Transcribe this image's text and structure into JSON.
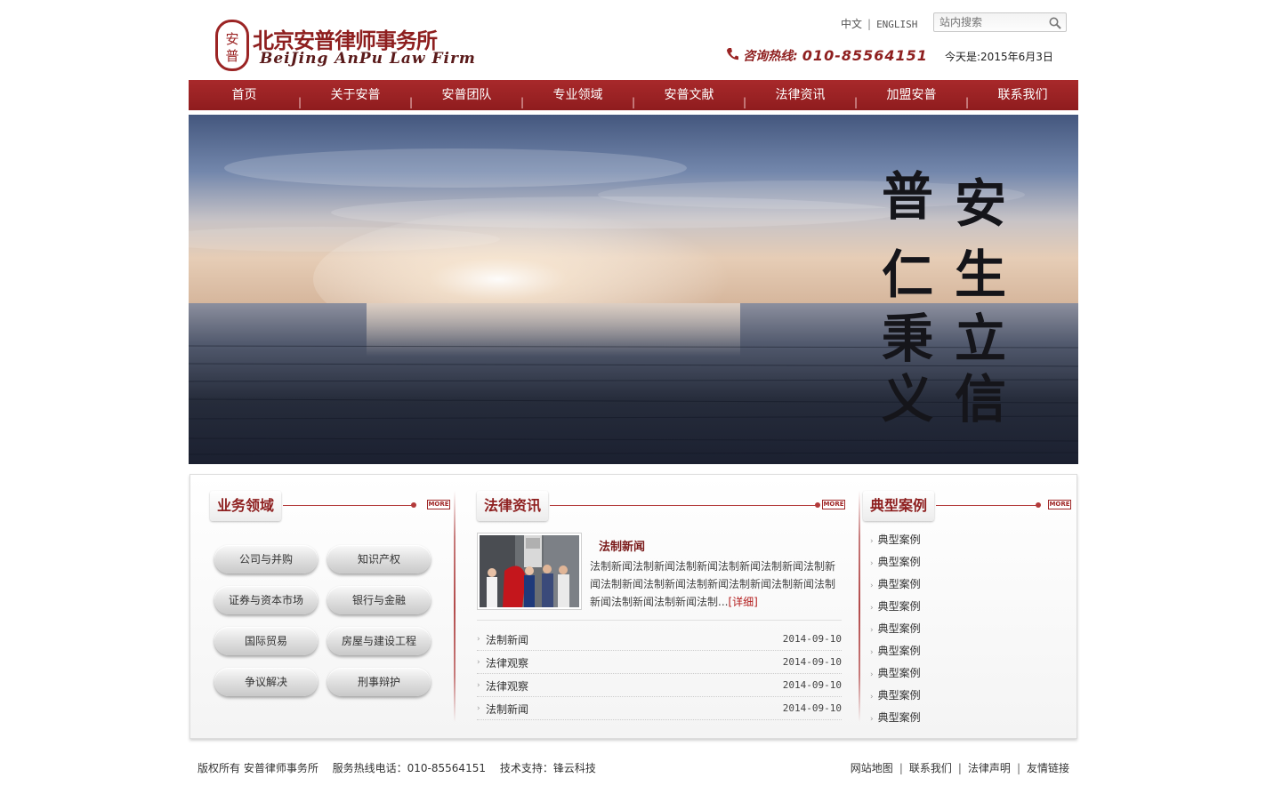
{
  "header": {
    "logo_seal_text": "安普",
    "logo_cn": "北京安普律师事务所",
    "logo_en": "BeiJing AnPu Law Firm",
    "lang_cn": "中文",
    "lang_en": "ENGLISH",
    "search_placeholder": "站内搜索",
    "hotline_label": "咨询热线:",
    "hotline_number": "010-85564151",
    "today_label": "今天是:",
    "today_date": "2015年6月3日"
  },
  "nav": {
    "items": [
      "首页",
      "关于安普",
      "安普团队",
      "专业领域",
      "安普文献",
      "法律资讯",
      "加盟安普",
      "联系我们"
    ]
  },
  "banner": {
    "calligraphy_col1": "普仁秉义",
    "calligraphy_col2": "安生立信"
  },
  "practice": {
    "title": "业务领域",
    "more": "MORE",
    "items": [
      "公司与并购",
      "知识产权",
      "证券与资本市场",
      "银行与金融",
      "国际贸易",
      "房屋与建设工程",
      "争议解决",
      "刑事辩护"
    ]
  },
  "news": {
    "title": "法律资讯",
    "more": "MORE",
    "featured_title": "法制新闻",
    "featured_text": "法制新闻法制新闻法制新闻法制新闻法制新闻法制新闻法制新闻法制新闻法制新闻法制新闻法制新闻法制新闻法制新闻法制新闻法制...",
    "detail_link": "[详细]",
    "list": [
      {
        "title": "法制新闻",
        "date": "2014-09-10"
      },
      {
        "title": "法律观察",
        "date": "2014-09-10"
      },
      {
        "title": "法律观察",
        "date": "2014-09-10"
      },
      {
        "title": "法制新闻",
        "date": "2014-09-10"
      }
    ]
  },
  "cases": {
    "title": "典型案例",
    "more": "MORE",
    "items": [
      "典型案例",
      "典型案例",
      "典型案例",
      "典型案例",
      "典型案例",
      "典型案例",
      "典型案例",
      "典型案例",
      "典型案例"
    ]
  },
  "footer": {
    "copyright": "版权所有 安普律师事务所",
    "service_hotline": "服务热线电话：010-85564151",
    "tech_support": "技术支持：锋云科技",
    "links": [
      "网站地图",
      "联系我们",
      "法律声明",
      "友情链接"
    ]
  },
  "colors": {
    "brand_red": "#8e1f1f",
    "nav_red": "#a8292b"
  }
}
